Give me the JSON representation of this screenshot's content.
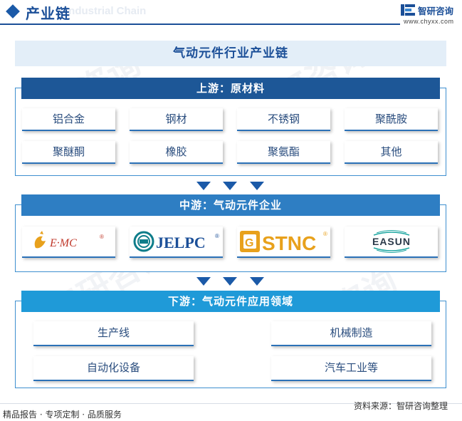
{
  "header": {
    "title": "产业链",
    "ghost_text": "Industrial Chain",
    "brand_name": "智研咨询",
    "brand_url": "www.chyxx.com",
    "accent_color": "#1b4f98"
  },
  "watermark_text": "智研咨询",
  "main_title": "气动元件行业产业链",
  "upstream": {
    "title": "上游：原材料",
    "items": [
      "铝合金",
      "钢材",
      "不锈钢",
      "聚酰胺",
      "聚醚酮",
      "橡胶",
      "聚氨酯",
      "其他"
    ],
    "head_color": "#1d5797"
  },
  "midstream": {
    "title": "中游：气动元件企业",
    "head_color": "#2e7ec3",
    "logos": [
      {
        "name": "emc-logo",
        "text": "E·MC",
        "mark": "®"
      },
      {
        "name": "jelpc-logo",
        "text": "JELPC",
        "mark": "®"
      },
      {
        "name": "stnc-logo",
        "text": "STNC",
        "mark": "®"
      },
      {
        "name": "easun-logo",
        "text": "EASUN"
      }
    ]
  },
  "downstream": {
    "title": "下游：气动元件应用领域",
    "head_color": "#1f9ad8",
    "items": [
      "生产线",
      "机械制造",
      "自动化设备",
      "汽车工业等"
    ]
  },
  "footer": {
    "left": "精品报告 · 专项定制 · 品质服务",
    "right": "资料来源：智研咨询整理"
  }
}
